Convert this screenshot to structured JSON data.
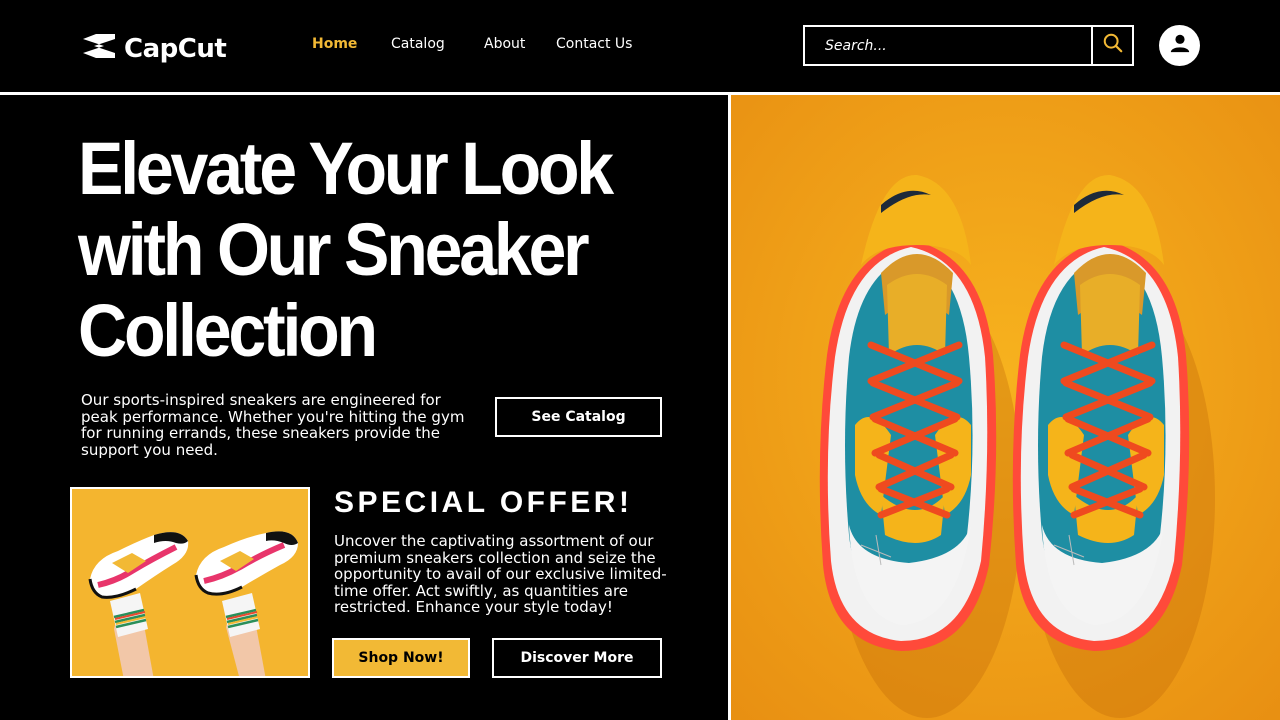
{
  "brand": {
    "name": "CapCut",
    "logo_icon": "capcut-logo-icon"
  },
  "nav": {
    "items": [
      {
        "label": "Home",
        "active": true
      },
      {
        "label": "Catalog",
        "active": false
      },
      {
        "label": "About",
        "active": false
      },
      {
        "label": "Contact Us",
        "active": false
      }
    ]
  },
  "search": {
    "placeholder": "Search...",
    "icon": "search-icon"
  },
  "user": {
    "icon": "user-icon"
  },
  "hero": {
    "title_lines": [
      "Elevate Your Look",
      "with Our Sneaker",
      "Collection"
    ],
    "description": "Our sports-inspired sneakers are engineered for peak performance. Whether you're hitting the gym for running errands, these sneakers provide the support you need.",
    "cta_label": "See Catalog"
  },
  "offer": {
    "title": "SPECIAL OFFER!",
    "description": "Uncover the captivating assortment of our premium sneakers collection and seize the opportunity to avail of our exclusive limited-time offer. Act swiftly, as quantities are restricted. Enhance your style today!",
    "primary_label": "Shop Now!",
    "secondary_label": "Discover More"
  },
  "colors": {
    "accent": "#f2b935",
    "background": "#000000",
    "image_background": "#f4a81d"
  }
}
